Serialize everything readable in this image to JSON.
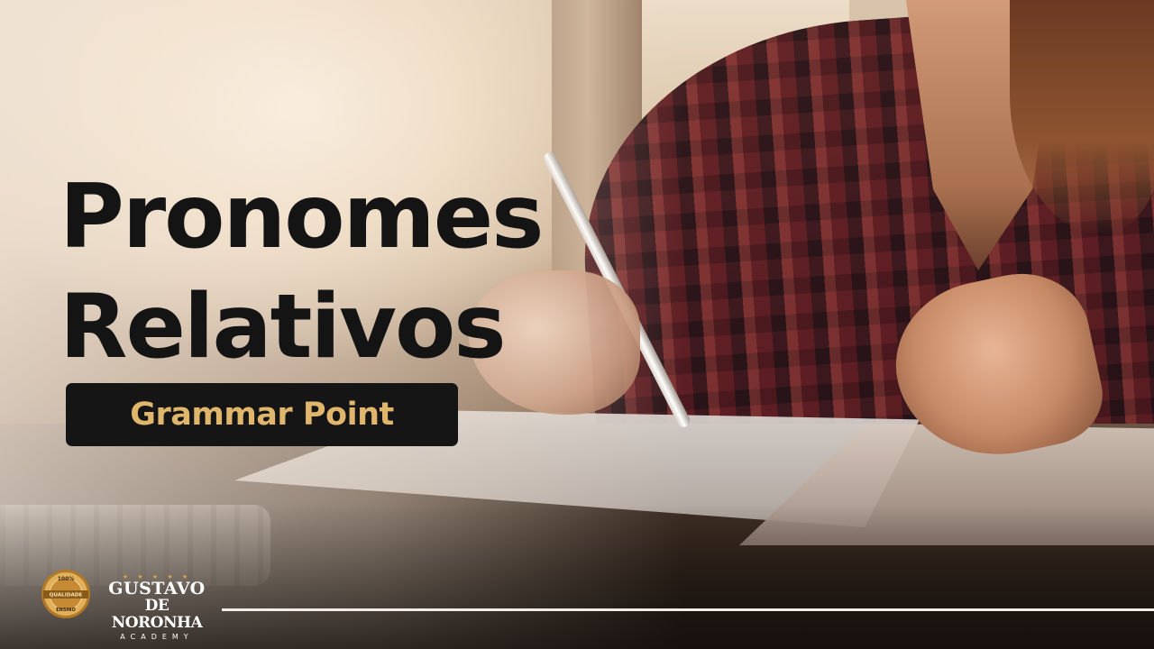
{
  "title": {
    "line1": "Pronomes",
    "line2": "Relativos"
  },
  "badge": {
    "label": "Grammar Point",
    "background": "#151515",
    "text_color": "#e0b66d"
  },
  "brand": {
    "seal_top": "100%",
    "seal_middle": "QUALIDADE",
    "seal_bottom": "ENSINO",
    "stars": "★ ★ ★ ★ ★",
    "name_line1": "GUSTAVO",
    "name_line2": "DE NORONHA",
    "name_line3": "ACADEMY",
    "seal_color": "#d8a448"
  },
  "icons": {
    "seal": "quality-seal-icon"
  }
}
